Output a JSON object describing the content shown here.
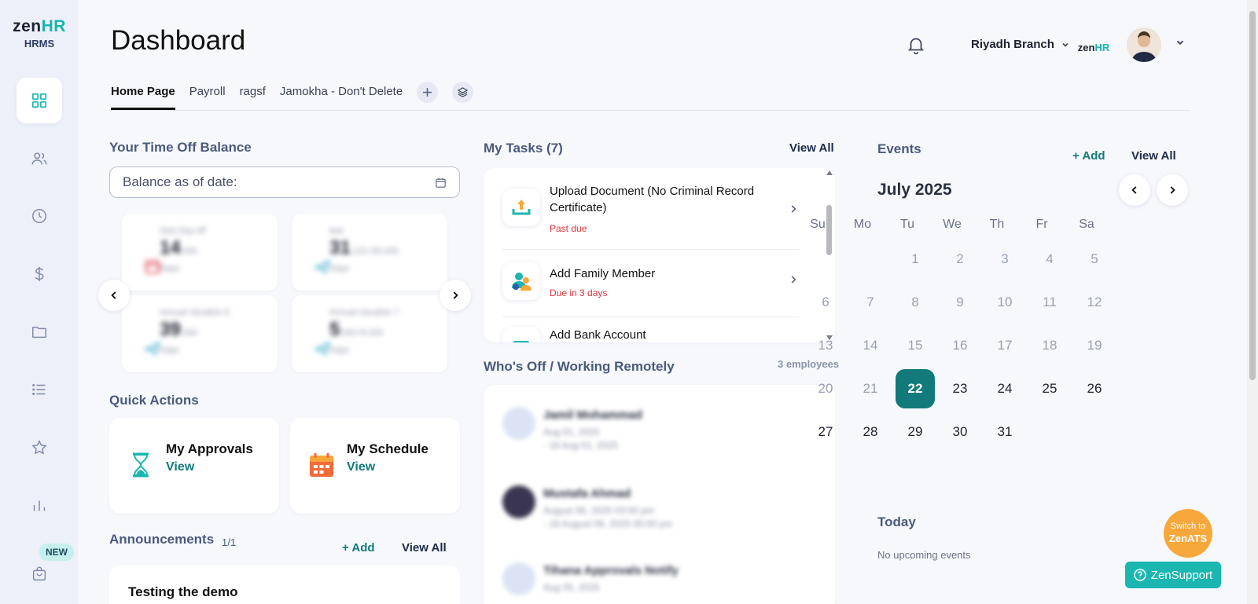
{
  "app": {
    "brand_prefix": "zen",
    "brand_suffix": "HR",
    "product": "HRMS",
    "new_badge": "NEW"
  },
  "header": {
    "title": "Dashboard",
    "branch": "Riyadh Branch",
    "logo_prefix": "zen",
    "logo_suffix": "HR"
  },
  "tabs": [
    {
      "label": "Home Page",
      "active": true
    },
    {
      "label": "Payroll"
    },
    {
      "label": "ragsf"
    },
    {
      "label": "Jamokha - Don't Delete"
    }
  ],
  "time_off": {
    "title": "Your Time Off Balance",
    "date_placeholder": "Balance as of date:",
    "cards": [
      {
        "label": "Sick Day off",
        "value": "14",
        "suffix": ".000",
        "unit": "Days"
      },
      {
        "label": "test",
        "value": "31",
        "suffix": ".123 /45.000",
        "unit": "Days"
      },
      {
        "label": "Annual Vacation 6",
        "value": "39",
        "suffix": ".000",
        "unit": "Days"
      },
      {
        "label": "Annual Vacation 7",
        "value": "5",
        "suffix": ".000 /5.000",
        "unit": "Days"
      }
    ]
  },
  "quick_actions": {
    "title": "Quick Actions",
    "items": [
      {
        "title": "My Approvals",
        "link": "View"
      },
      {
        "title": "My Schedule",
        "link": "View"
      }
    ]
  },
  "announcements": {
    "title": "Announcements",
    "count": "1/1",
    "add": "+ Add",
    "view_all": "View All",
    "first": "Testing the demo"
  },
  "tasks": {
    "title": "My Tasks (7)",
    "view_all": "View All",
    "items": [
      {
        "name": "Upload Document (No Criminal Record Certificate)",
        "due": "Past due"
      },
      {
        "name": "Add Family Member",
        "due": "Due in 3 days"
      },
      {
        "name": "Add Bank Account",
        "due": ""
      }
    ]
  },
  "whos_off": {
    "title": "Who's Off / Working Remotely",
    "count": "3 employees",
    "people": [
      {
        "name": "Jamil Mohammad",
        "line1": "Aug 01, 2025",
        "line2": "- 18 Aug 01, 2025"
      },
      {
        "name": "Mustafa Ahmad",
        "line1": "August 06, 2025 03:00 pm",
        "line2": "- 18 August 06, 2025 05:00 pm"
      },
      {
        "name": "Tihana Approvals Notify",
        "line1": "Aug 05, 2025",
        "line2": ""
      }
    ]
  },
  "events": {
    "title": "Events",
    "add": "+ Add",
    "view_all": "View All",
    "month": "July 2025",
    "weekdays": [
      "Su",
      "Mo",
      "Tu",
      "We",
      "Th",
      "Fr",
      "Sa"
    ],
    "first_weekday": 2,
    "days_in_month": 31,
    "today": 22,
    "today_title": "Today",
    "no_events": "No upcoming events"
  },
  "floating": {
    "ats_line1": "Switch to",
    "ats_line2": "ZenATS",
    "support": "ZenSupport"
  },
  "colors": {
    "accent": "#127a7a",
    "brand": "#17b6b1",
    "orange": "#f7a83b",
    "danger": "#e0343e"
  }
}
